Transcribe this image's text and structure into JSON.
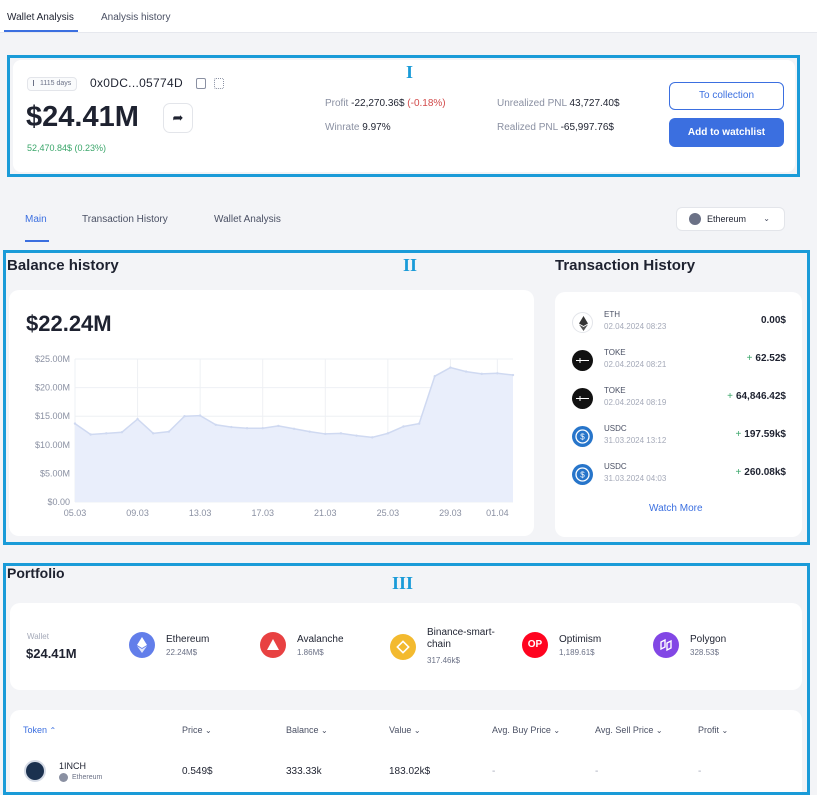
{
  "top_tabs": [
    "Wallet Analysis",
    "Analysis history"
  ],
  "header": {
    "days": "1115 days",
    "address": "0x0DC...05774D",
    "total_value": "$24.41M",
    "change": "52,470.84$ (0.23%)",
    "profit_label": "Profit",
    "profit_value": "-22,270.36$",
    "profit_pct": "(-0.18%)",
    "winrate_label": "Winrate",
    "winrate_value": "9.97%",
    "unrealized_label": "Unrealized PNL",
    "unrealized_value": "43,727.40$",
    "realized_label": "Realized PNL",
    "realized_value": "-65,997.76$",
    "to_collection": "To collection",
    "add_watchlist": "Add to watchlist"
  },
  "labels": {
    "section1": "I",
    "section2": "II",
    "section3": "III"
  },
  "sub_tabs": [
    "Main",
    "Transaction History",
    "Wallet Analysis"
  ],
  "chain_select": "Ethereum",
  "balance": {
    "title": "Balance history",
    "value": "$22.24M"
  },
  "chart_data": {
    "type": "area",
    "title": "",
    "xlabel": "",
    "ylabel": "",
    "ylim": [
      0,
      25
    ],
    "yticks": [
      "$25.00M",
      "$20.00M",
      "$15.00M",
      "$10.00M",
      "$5.00M",
      "$0.00"
    ],
    "xticks": [
      "05.03",
      "09.03",
      "13.03",
      "17.03",
      "21.03",
      "25.03",
      "29.03",
      "01.04"
    ],
    "grid": true,
    "series": [
      {
        "x": [
          "05.03",
          "06.03",
          "07.03",
          "08.03",
          "09.03",
          "10.03",
          "11.03",
          "12.03",
          "13.03",
          "14.03",
          "15.03",
          "16.03",
          "17.03",
          "18.03",
          "19.03",
          "20.03",
          "21.03",
          "22.03",
          "23.03",
          "24.03",
          "25.03",
          "26.03",
          "27.03",
          "28.03",
          "29.03",
          "30.03",
          "31.03",
          "01.04",
          "02.04"
        ],
        "values": [
          13.7,
          11.8,
          12.0,
          12.2,
          14.5,
          12.0,
          12.3,
          15.0,
          15.1,
          13.5,
          13.1,
          12.9,
          12.9,
          13.3,
          12.8,
          12.3,
          11.9,
          12.0,
          11.6,
          11.3,
          12.0,
          13.2,
          13.7,
          22.0,
          23.5,
          22.8,
          22.4,
          22.5,
          22.2
        ]
      }
    ]
  },
  "transactions": {
    "title": "Transaction History",
    "items": [
      {
        "symbol": "ETH",
        "date": "02.04.2024 08:23",
        "sign": "",
        "amount": "0.00$"
      },
      {
        "symbol": "TOKE",
        "date": "02.04.2024 08:21",
        "sign": "+",
        "amount": "62.52$"
      },
      {
        "symbol": "TOKE",
        "date": "02.04.2024 08:19",
        "sign": "+",
        "amount": "64,846.42$"
      },
      {
        "symbol": "USDC",
        "date": "31.03.2024 13:12",
        "sign": "+",
        "amount": "197.59k$"
      },
      {
        "symbol": "USDC",
        "date": "31.03.2024 04:03",
        "sign": "+",
        "amount": "260.08k$"
      }
    ],
    "watch_more": "Watch More"
  },
  "portfolio": {
    "title": "Portfolio",
    "wallet_label": "Wallet",
    "wallet_value": "$24.41M",
    "chains": [
      {
        "name": "Ethereum",
        "value": "22.24M$",
        "color": "#627eea"
      },
      {
        "name": "Avalanche",
        "value": "1.86M$",
        "color": "#e84142"
      },
      {
        "name": "Binance-smart-chain",
        "value": "317.46k$",
        "color": "#f3ba2f"
      },
      {
        "name": "Optimism",
        "value": "1,189.61$",
        "color": "#ff0420"
      },
      {
        "name": "Polygon",
        "value": "328.53$",
        "color": "#8247e5"
      }
    ],
    "op_glyph": "OP",
    "columns": [
      "Token",
      "Price",
      "Balance",
      "Value",
      "Avg. Buy Price",
      "Avg. Sell Price",
      "Profit"
    ],
    "rows": [
      {
        "token": "1INCH",
        "chain": "Ethereum",
        "price": "0.549$",
        "balance": "333.33k",
        "value": "183.02k$",
        "avg_buy": "-",
        "avg_sell": "-",
        "profit": "-"
      }
    ]
  }
}
